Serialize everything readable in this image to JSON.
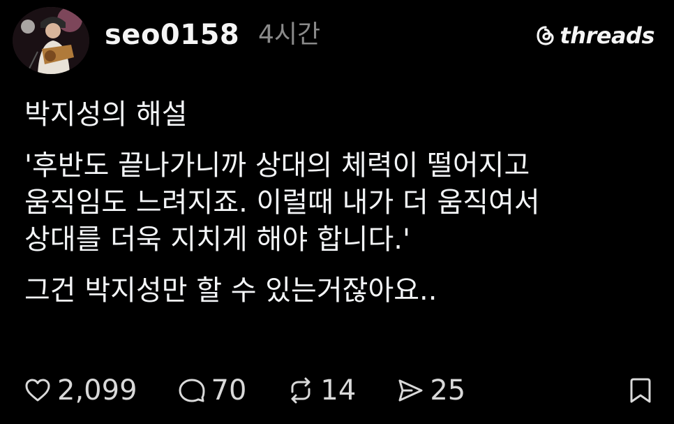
{
  "post": {
    "username": "seo0158",
    "time": "4시간",
    "brand": "threads",
    "paragraphs": [
      "박지성의 해설",
      "'후반도 끝나가니까 상대의 체력이 떨어지고\n움직임도 느려지죠. 이럴때 내가 더 움직여서\n상대를 더욱 지치게 해야 합니다.'",
      "그건 박지성만 할 수 있는거잖아요.."
    ],
    "likes": "2,099",
    "comments": "70",
    "reposts": "14",
    "shares": "25"
  },
  "icons": {
    "avatar": "avatar",
    "brand": "threads-logo-icon",
    "like": "heart-icon",
    "comment": "comment-icon",
    "repost": "repost-icon",
    "share": "share-icon",
    "bookmark": "bookmark-icon"
  }
}
